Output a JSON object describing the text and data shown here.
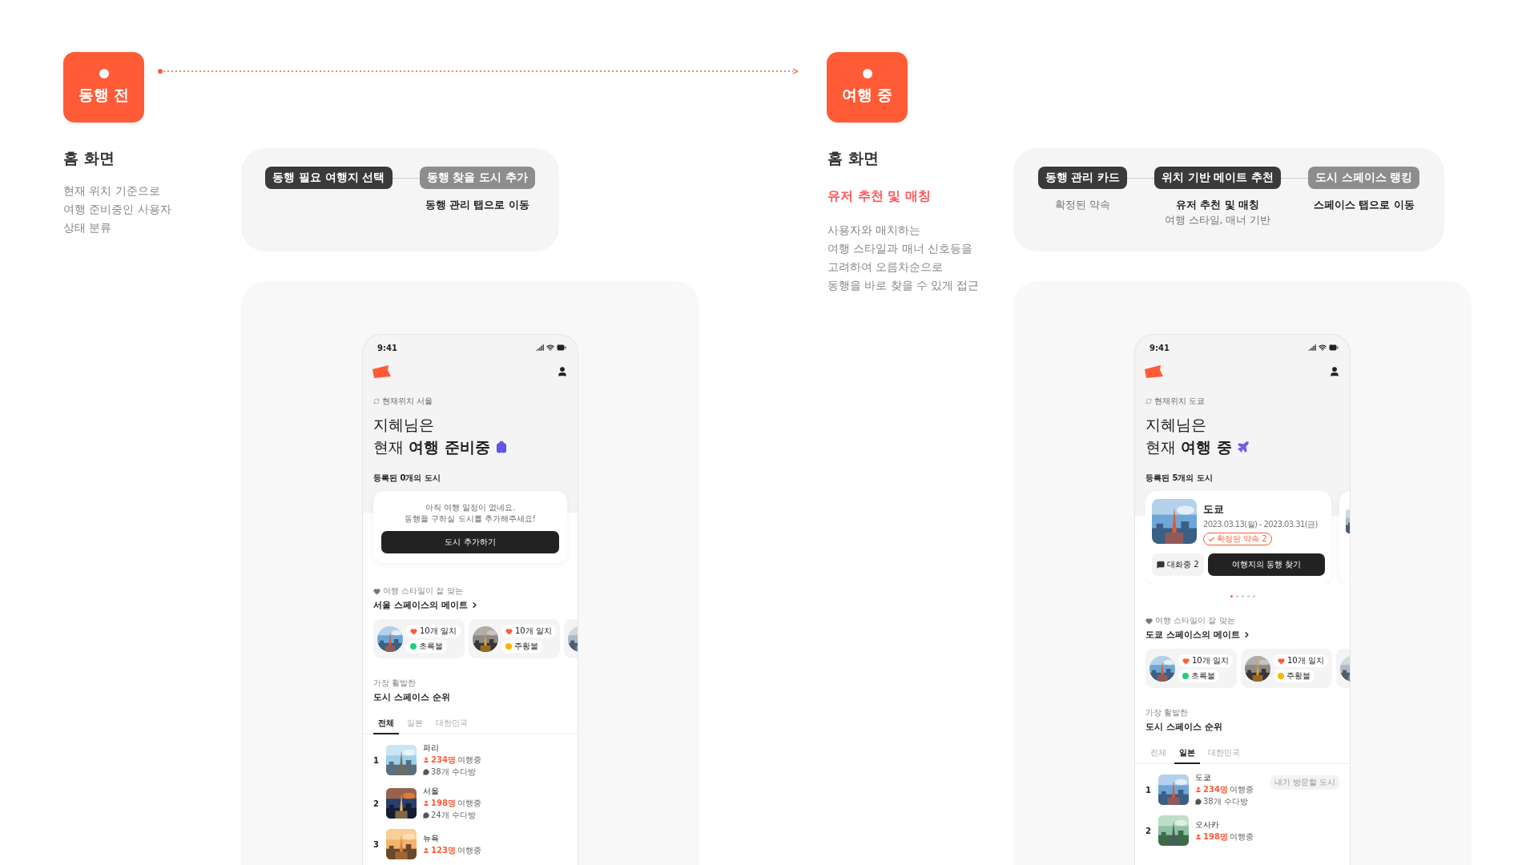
{
  "stages": [
    {
      "badge": "동행 전",
      "heading": "홈 화면",
      "description": [
        "현재 위치 기준으로",
        "여행 준비중인 사용자",
        "상태 분류"
      ],
      "flow": {
        "steps": [
          {
            "label": "동행 필요 여행지 선택",
            "active": true
          },
          {
            "label": "동행 찾을 도시 추가",
            "active": false,
            "caption": "동행 관리 탭으로 이동"
          }
        ]
      },
      "phone": {
        "status_time": "9:41",
        "location": "현재위치 서울",
        "greeting": "지혜님은",
        "status": {
          "text": "현재 **여행 준비중**",
          "kind": "preparing"
        },
        "cities_label": "등록된 0개의 도시",
        "cities": {
          "kind": "empty",
          "message": [
            "아직 여행 일정이 없네요.",
            "동행을 구하실 도시를 추가해주세요!"
          ],
          "button": "도시 추가하기"
        },
        "mates": {
          "subtitle": "여행 스타일이 잘 맞는",
          "title": "서울 스페이스의 메이트",
          "cards": [
            {
              "kind": "full",
              "match": "10개 일치",
              "status": "초록불",
              "color": "#1fd17c"
            },
            {
              "kind": "full",
              "match": "10개 일치",
              "status": "주황불",
              "color": "#ffb400"
            },
            {
              "kind": "partial"
            }
          ]
        },
        "ranking": {
          "subtitle": "가장 활발한",
          "title": "도시 스페이스 순위",
          "tabs": [
            {
              "label": "전체",
              "selected": true
            },
            {
              "label": "일본",
              "selected": false
            },
            {
              "label": "대한민국",
              "selected": false
            }
          ],
          "rows": [
            {
              "rank": "1",
              "name": "파리",
              "count": "234명",
              "count_label": "여행중",
              "chats": "38개 수다방"
            },
            {
              "rank": "2",
              "name": "서울",
              "count": "198명",
              "count_label": "여행중",
              "chats": "24개 수다방"
            },
            {
              "rank": "3",
              "name": "뉴욕",
              "count": "123명",
              "count_label": "여행중"
            }
          ]
        }
      }
    },
    {
      "badge": "여행 중",
      "heading": "홈 화면",
      "highlight": "유저 추천 및 매칭",
      "description": [
        "사용자와 매치하는",
        "여행 스타일과 매너 신호등을",
        "고려하여 오름차순으로",
        "동행을 바로 찾을 수 있게 접근"
      ],
      "flow": {
        "steps": [
          {
            "label": "동행 관리 카드",
            "active": true,
            "note": "확정된 약속"
          },
          {
            "label": "위치 기반 메이트 추천",
            "active": true,
            "caption": "유저 추천 및 매칭",
            "note": "여행 스타일, 매너 기반"
          },
          {
            "label": "도시 스페이스 랭킹",
            "active": false,
            "caption": "스페이스 탭으로 이동"
          }
        ]
      },
      "phone": {
        "status_time": "9:41",
        "location": "현재위치 도쿄",
        "greeting": "지혜님은",
        "status": {
          "text": "현재 **여행 중**",
          "kind": "traveling"
        },
        "cities_label": "등록된 5개의 도시",
        "cities": {
          "kind": "carousel",
          "cards": [
            {
              "kind": "full",
              "name": "도쿄",
              "dates": "2023.03.13(월) - 2023.03.31(금)",
              "promise": "확정된 약속 2",
              "chat": "대화중 2",
              "button": "여행지의 동행 찾기"
            },
            {
              "kind": "partial"
            }
          ],
          "pages": [
            {
              "selected": true
            },
            {
              "selected": false
            },
            {
              "selected": false
            },
            {
              "selected": false
            },
            {
              "selected": false
            }
          ]
        },
        "mates": {
          "subtitle": "여행 스타일이 잘 맞는",
          "title": "도쿄 스페이스의 메이트",
          "cards": [
            {
              "kind": "full",
              "match": "10개 일치",
              "status": "초록불",
              "color": "#1fd17c"
            },
            {
              "kind": "full",
              "match": "10개 일치",
              "status": "주황불",
              "color": "#ffb400"
            },
            {
              "kind": "partial"
            }
          ]
        },
        "ranking": {
          "subtitle": "가장 활발한",
          "title": "도시 스페이스 순위",
          "tabs": [
            {
              "label": "전체",
              "selected": false
            },
            {
              "label": "일본",
              "selected": true
            },
            {
              "label": "대한민국",
              "selected": false
            }
          ],
          "rows": [
            {
              "rank": "1",
              "name": "도쿄",
              "count": "234명",
              "count_label": "여행중",
              "chats": "38개 수다방",
              "tag": "내가 방문할 도시"
            },
            {
              "rank": "2",
              "name": "오사카",
              "count": "198명",
              "count_label": "여행중"
            }
          ]
        }
      }
    }
  ]
}
